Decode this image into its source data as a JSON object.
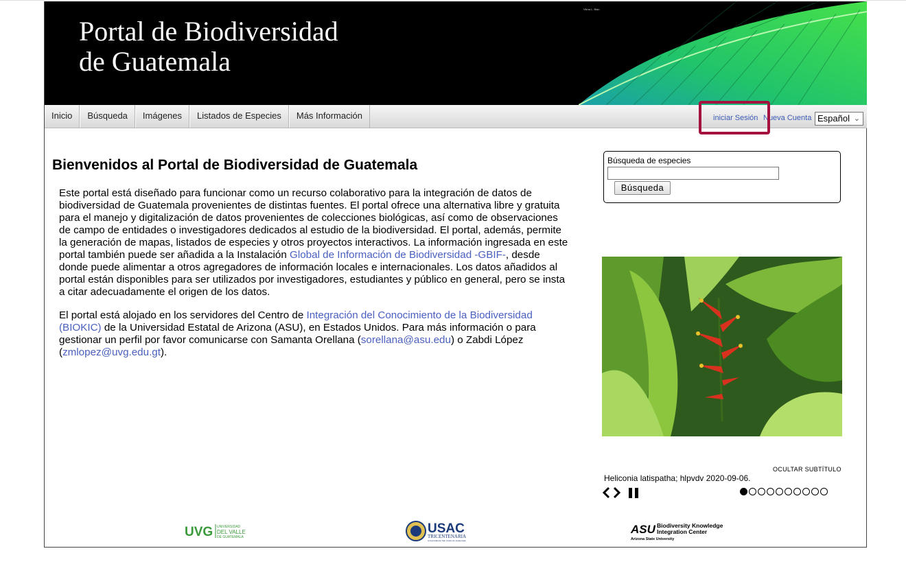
{
  "header": {
    "title_line1": "Portal de Biodiversidad",
    "title_line2": "de Guatemala",
    "photo_credit": "Vilma L. Blan"
  },
  "nav": {
    "items": [
      "Inicio",
      "Búsqueda",
      "Imágenes",
      "Listados de Especies",
      "Más Información"
    ],
    "login": "iniciar Sesión",
    "new_account": "Nueva Cuenta",
    "language": "Español"
  },
  "main": {
    "heading": "Bienvenidos al Portal de Biodiversidad de Guatemala",
    "p1_a": "Este portal está diseñado para funcionar como un recurso colaborativo para la integración de datos de biodiversidad de Guatemala provenientes de distintas fuentes. El portal ofrece una alternativa libre y gratuita para el manejo y digitalización de datos provenientes de colecciones biológicas, así como de observaciones de campo de entidades o investigadores dedicados al estudio de la biodiversidad. El portal, además, permite la generación de mapas, listados de especies y otros proyectos interactivos. La información ingresada en este portal también puede ser añadida a la Instalación ",
    "p1_link": "Global de Información de Biodiversidad -GBIF-",
    "p1_b": ", desde donde puede alimentar a otros agregadores de información locales e internacionales. Los datos añadidos al portal están disponibles para ser utilizados por investigadores, estudiantes y público en general, pero se insta a citar adecuadamente el origen de los datos.",
    "p2_a": "El portal está alojado en los servidores del Centro de ",
    "p2_link1": "Integración del Conocimiento de la Biodiversidad (BIOKIC)",
    "p2_b": " de la Universidad Estatal de Arizona (ASU), en Estados Unidos. Para más información o para gestionar un perfil por favor comunicarse con Samanta Orellana (",
    "p2_email1": "sorellana@asu.edu",
    "p2_c": ") o Zabdi López (",
    "p2_email2": "zmlopez@uvg.edu.gt",
    "p2_d": ")."
  },
  "search": {
    "label": "Búsqueda de especies",
    "value": "",
    "button": "Búsqueda"
  },
  "slideshow": {
    "hide_caption": "OCULTAR SUBTÍTULO",
    "caption": "Heliconia latispatha; hlpvdv 2020-09-06.",
    "total_slides": 10,
    "active_slide": 1
  },
  "footer": {
    "uvg": {
      "abbr": "UVG",
      "line1": "UNIVERSIDAD",
      "line2": "DEL VALLE",
      "line3": "DE GUATEMALA"
    },
    "usac": {
      "abbr": "USAC",
      "line1": "TRICENTENARIA",
      "line2": "Universidad de San Carlos de Guatemala"
    },
    "asu": {
      "abbr": "ASU",
      "line1": "Biodiversity Knowledge",
      "line2": "Integration Center",
      "line3": "Arizona State University"
    }
  },
  "colors": {
    "accent_link": "#4a5fbf",
    "highlight": "#a4123f",
    "uvg_green": "#3a9a3a",
    "usac_blue": "#1a3a7a"
  }
}
